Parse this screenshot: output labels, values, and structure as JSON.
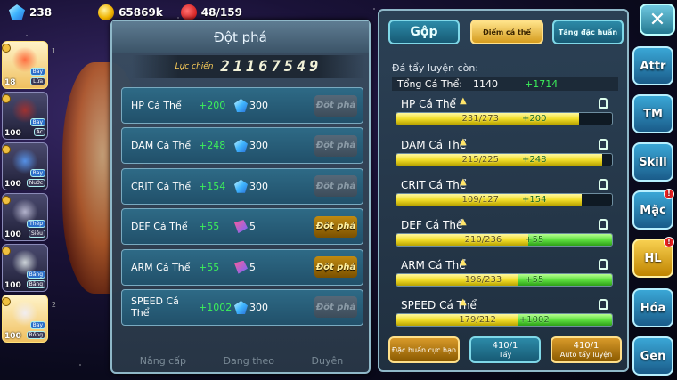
{
  "resources": {
    "gems": "238",
    "gold": "65869k",
    "fruit": "48/159"
  },
  "team": [
    {
      "level": "18",
      "tag1": "Bay",
      "tag2": "Lửa",
      "side": "1",
      "selected": true
    },
    {
      "level": "100",
      "tag1": "Bay",
      "tag2": "Ác",
      "side": "",
      "selected": false
    },
    {
      "level": "100",
      "tag1": "Bay",
      "tag2": "Nước",
      "side": "",
      "selected": false
    },
    {
      "level": "100",
      "tag1": "Thép",
      "tag2": "Siêu",
      "side": "",
      "selected": false
    },
    {
      "level": "100",
      "tag1": "Băng",
      "tag2": "Băng",
      "side": "",
      "selected": false
    },
    {
      "level": "100",
      "tag1": "Bay",
      "tag2": "Rồng",
      "side": "2",
      "selected": true
    }
  ],
  "breakthrough": {
    "title": "Đột phá",
    "power_label": "Lực chiến",
    "power_value": "21167549",
    "rows": [
      {
        "name": "HP Cá Thể",
        "gain": "+200",
        "cost": "300",
        "cost_icon": "gem-icon",
        "button": "Đột phá",
        "enabled": false
      },
      {
        "name": "DAM Cá Thể",
        "gain": "+248",
        "cost": "300",
        "cost_icon": "gem-icon",
        "button": "Đột phá",
        "enabled": false
      },
      {
        "name": "CRIT Cá Thể",
        "gain": "+154",
        "cost": "300",
        "cost_icon": "gem-icon",
        "button": "Đột phá",
        "enabled": false
      },
      {
        "name": "DEF Cá Thể",
        "gain": "+55",
        "cost": "5",
        "cost_icon": "ticket-icon",
        "button": "Đột phá",
        "enabled": true
      },
      {
        "name": "ARM Cá Thể",
        "gain": "+55",
        "cost": "5",
        "cost_icon": "ticket-icon",
        "button": "Đột phá",
        "enabled": true
      },
      {
        "name": "SPEED Cá Thể",
        "gain": "+1002",
        "cost": "300",
        "cost_icon": "gem-icon",
        "button": "Đột phá",
        "enabled": false
      }
    ],
    "footer": [
      "Nâng cấp",
      "Đang theo",
      "Duyên"
    ]
  },
  "training": {
    "tabs": {
      "merge": "Gộp",
      "individual": "Điểm cá thể",
      "special": "Tăng đặc huấn"
    },
    "remaining_label": "Đá tẩy luyện còn:",
    "total_label": "Tổng Cá Thể:",
    "total_value": "1140",
    "total_gain": "+1714",
    "stats": [
      {
        "name": "HP Cá Thể",
        "current": 231,
        "max": 273,
        "gain": "+200",
        "value_text": "231/273"
      },
      {
        "name": "DAM Cá Thể",
        "current": 215,
        "max": 225,
        "gain": "+248",
        "value_text": "215/225"
      },
      {
        "name": "CRIT Cá Thể",
        "current": 109,
        "max": 127,
        "gain": "+154",
        "value_text": "109/127"
      },
      {
        "name": "DEF Cá Thể",
        "current": 210,
        "max": 236,
        "gain": "+55",
        "value_text": "210/236"
      },
      {
        "name": "ARM Cá Thể",
        "current": 196,
        "max": 233,
        "gain": "+55",
        "value_text": "196/233"
      },
      {
        "name": "SPEED Cá Thể",
        "current": 179,
        "max": 212,
        "gain": "+1002",
        "value_text": "179/212"
      }
    ],
    "buttons": {
      "special_training": "Đặc huấn cực hạn",
      "wash_count": "410/1",
      "wash_label": "Tẩy",
      "auto_count": "410/1",
      "auto_label": "Auto tẩy luyện"
    }
  },
  "side_menu": [
    {
      "label": "Attr",
      "badge": false
    },
    {
      "label": "TM",
      "badge": false
    },
    {
      "label": "Skill",
      "badge": false
    },
    {
      "label": "Mặc",
      "badge": true
    },
    {
      "label": "HL",
      "badge": true,
      "active": true
    },
    {
      "label": "Hóa",
      "badge": false
    },
    {
      "label": "Gen",
      "badge": false
    }
  ],
  "colors": {
    "gain": "#3cf05a",
    "bar_fill": "#f2de2a",
    "accent_gold": "#ffe08a",
    "panel_border": "#8fb8c8"
  }
}
